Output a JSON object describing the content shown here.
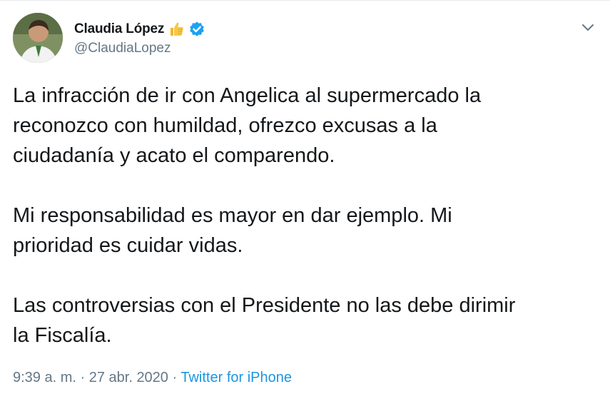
{
  "author": {
    "display_name": "Claudia López",
    "handle": "@ClaudiaLopez",
    "badges": [
      "thumbs-up-emoji",
      "verified-badge"
    ]
  },
  "tweet": {
    "paragraphs": [
      "La infracción de ir con Angelica al supermercado la\nreconozco con humildad, ofrezco excusas a la\nciudadanía y acato el comparendo.",
      "Mi responsabilidad es mayor en dar ejemplo. Mi\nprioridad es cuidar vidas.",
      "Las controversias con el Presidente no las debe dirimir\nla Fiscalía."
    ]
  },
  "meta": {
    "time": "9:39 a. m.",
    "separator1": " · ",
    "date": "27 abr. 2020",
    "separator2": " · ",
    "source": "Twitter for iPhone"
  },
  "colors": {
    "text": "#14171a",
    "secondary": "#657786",
    "link": "#1b95e0",
    "verified": "#1da1f2"
  },
  "icons": {
    "menu": "chevron-down-icon"
  }
}
